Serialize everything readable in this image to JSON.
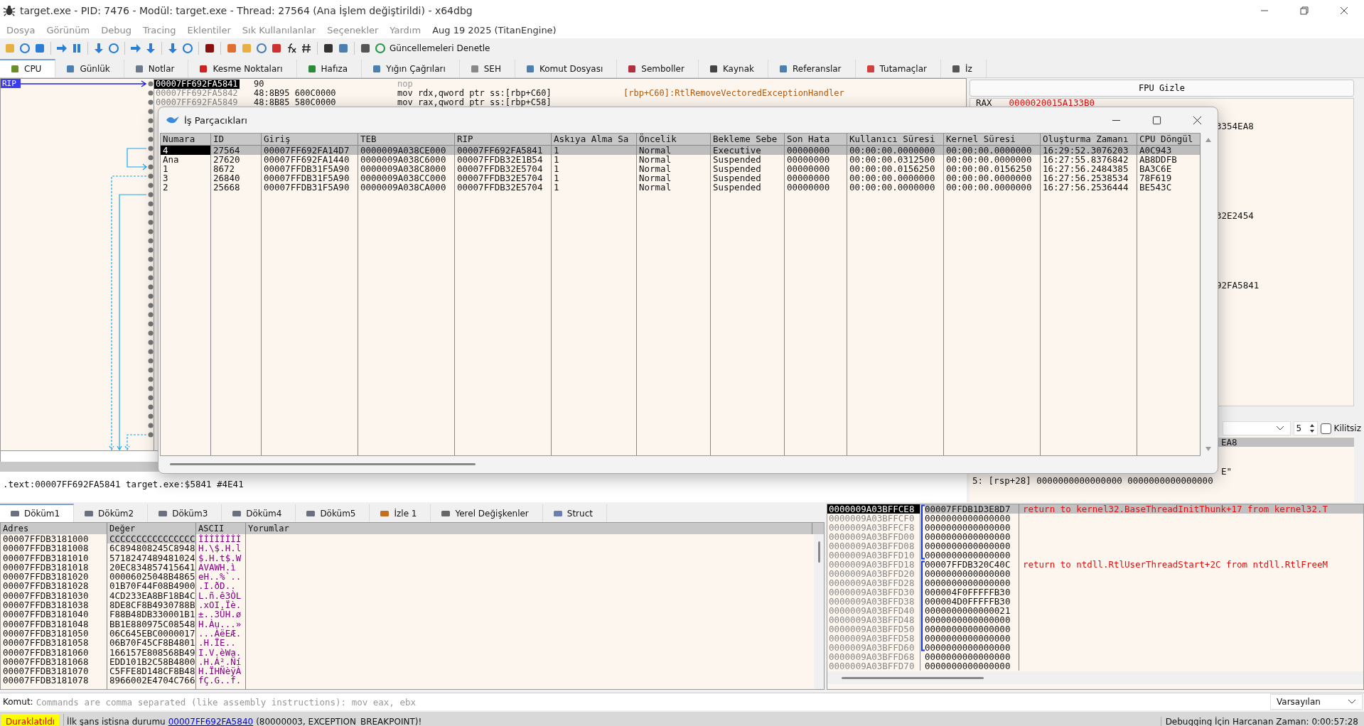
{
  "window": {
    "title": "target.exe - PID: 7476 - Modül: target.exe - Thread: 27564 (Ana İşlem değiştirildi) - x64dbg"
  },
  "menu": {
    "items": [
      "Dosya",
      "Görünüm",
      "Debug",
      "Tracing",
      "Eklentiler",
      "Sık Kullanılanlar",
      "Seçenekler",
      "Yardım"
    ],
    "build": "Aug 19 2025 (TitanEngine)"
  },
  "toolbar": {
    "update_label": "Güncellemeleri Denetle"
  },
  "tabs": [
    {
      "label": "CPU",
      "selected": true
    },
    {
      "label": "Günlük",
      "selected": false
    },
    {
      "label": "Notlar",
      "selected": false
    },
    {
      "label": "Kesme Noktaları",
      "selected": false
    },
    {
      "label": "Hafıza",
      "selected": false
    },
    {
      "label": "Yığın Çağrıları",
      "selected": false
    },
    {
      "label": "SEH",
      "selected": false
    },
    {
      "label": "Komut Dosyası",
      "selected": false
    },
    {
      "label": "Semboller",
      "selected": false
    },
    {
      "label": "Kaynak",
      "selected": false
    },
    {
      "label": "Referanslar",
      "selected": false
    },
    {
      "label": "Tutamaçlar",
      "selected": false
    },
    {
      "label": "İz",
      "selected": false
    }
  ],
  "disassembly": {
    "rip_label": "RIP",
    "rows": [
      {
        "address": "00007FF692FA5841",
        "bytes": "90",
        "instruction": "nop",
        "comment": null,
        "selected": true
      },
      {
        "address": "00007FF692FA5842",
        "bytes": "48:8B95 600C0000",
        "instruction": "mov rdx,qword ptr ss:[rbp+C60]",
        "comment": "[rbp+C60]:RtlRemoveVectoredExceptionHandler",
        "selected": false
      },
      {
        "address": "00007FF692FA5849",
        "bytes": "48:8B85 580C0000",
        "instruction": "mov rax,qword ptr ss:[rbp+C58]",
        "comment": null,
        "selected": false
      }
    ]
  },
  "info_line": ".text:00007FF692FA5841 target.exe:$5841 #4E41",
  "registers": {
    "toggle_label": "FPU Gizle",
    "rows": [
      {
        "name": "RAX",
        "value": "0000020015A133B0",
        "changed": true
      }
    ],
    "fragments": [
      "3354EA8",
      "32E2454",
      "92FA5841"
    ]
  },
  "arguments": {
    "count": "5",
    "lock_label": "Kilitsiz",
    "locked": false,
    "lines": [
      {
        "text": "EA8",
        "selected": true
      },
      {
        "text": "E\"",
        "selected": false
      },
      {
        "text": "5: [rsp+28] 0000000000000000 0000000000000000",
        "selected": false
      }
    ]
  },
  "threads_dialog": {
    "title": "İş Parçacıkları",
    "columns": [
      "Numara",
      "ID",
      "Giriş",
      "TEB",
      "RIP",
      "Askıya Alma Sa",
      "Öncelik",
      "Bekleme Sebe",
      "Son Hata",
      "Kullanıcı Süresi",
      "Kernel Süresi",
      "Oluşturma Zamanı",
      "CPU Döngül"
    ],
    "rows": [
      {
        "cells": [
          "4",
          "27564",
          "00007FF692FA14D7",
          "0000009A038CE000",
          "00007FF692FA5841",
          "1",
          "Normal",
          "Executive",
          "00000000",
          "00:00:00.0000000",
          "00:00:00.0000000",
          "16:29:52.3076203",
          "A0C943"
        ],
        "selected": true
      },
      {
        "cells": [
          "Ana",
          "27620",
          "00007FF692FA1440",
          "0000009A038C6000",
          "00007FFDB32E1B54",
          "1",
          "Normal",
          "Suspended",
          "00000000",
          "00:00:00.0312500",
          "00:00:00.0000000",
          "16:27:55.8376842",
          "AB8DDFB"
        ],
        "selected": false
      },
      {
        "cells": [
          "1",
          "8672",
          "00007FFDB31F5A90",
          "0000009A038C8000",
          "00007FFDB32E5704",
          "1",
          "Normal",
          "Suspended",
          "00000000",
          "00:00:00.0156250",
          "00:00:00.0156250",
          "16:27:56.2484385",
          "BA3C6E"
        ],
        "selected": false
      },
      {
        "cells": [
          "3",
          "26840",
          "00007FFDB31F5A90",
          "0000009A038CC000",
          "00007FFDB32E5704",
          "1",
          "Normal",
          "Suspended",
          "00000000",
          "00:00:00.0000000",
          "00:00:00.0000000",
          "16:27:56.2538534",
          "78F619"
        ],
        "selected": false
      },
      {
        "cells": [
          "2",
          "25668",
          "00007FFDB31F5A90",
          "0000009A038CA000",
          "00007FFDB32E5704",
          "1",
          "Normal",
          "Suspended",
          "00000000",
          "00:00:00.0000000",
          "00:00:00.0000000",
          "16:27:56.2536444",
          "BE543C"
        ],
        "selected": false
      }
    ]
  },
  "dump_tabs": [
    {
      "label": "Döküm1",
      "selected": true
    },
    {
      "label": "Döküm2",
      "selected": false
    },
    {
      "label": "Döküm3",
      "selected": false
    },
    {
      "label": "Döküm4",
      "selected": false
    },
    {
      "label": "Döküm5",
      "selected": false
    },
    {
      "label": "İzle 1",
      "selected": false
    },
    {
      "label": "Yerel Değişkenler",
      "selected": false
    },
    {
      "label": "Struct",
      "selected": false
    }
  ],
  "dump": {
    "columns": [
      "Adres",
      "Değer",
      "ASCII",
      "Yorumlar"
    ],
    "rows": [
      {
        "address": "00007FFDB3181000",
        "value": "CCCCCCCCCCCCCCCC",
        "ascii": "ÌÌÌÌÌÌÌÌ",
        "selected": true
      },
      {
        "address": "00007FFDB3181008",
        "value": "6C894808245C8948",
        "ascii": "H.\\$.H.l",
        "selected": false
      },
      {
        "address": "00007FFDB3181010",
        "value": "5718247489481024",
        "ascii": "$.H.t$.W",
        "selected": false
      },
      {
        "address": "00007FFDB3181018",
        "value": "20EC834857415641",
        "ascii": "AVAWH.ì",
        "selected": false
      },
      {
        "address": "00007FFDB3181020",
        "value": "00006025048B4865",
        "ascii": "eH..%`..",
        "selected": false
      },
      {
        "address": "00007FFDB3181028",
        "value": "01B70F44F08B4900",
        "ascii": ".I.ðD..",
        "selected": false
      },
      {
        "address": "00007FFDB3181030",
        "value": "4CD233EA8BF18B4C",
        "ascii": "L.ñ.ê3ÒL",
        "selected": false
      },
      {
        "address": "00007FFDB3181038",
        "value": "8DE8CF8B4930788B",
        "ascii": ".xOI.Ïè.",
        "selected": false
      },
      {
        "address": "00007FFDB3181040",
        "value": "F88B48DB330001B1",
        "ascii": "±..3ÛH.ø",
        "selected": false
      },
      {
        "address": "00007FFDB3181048",
        "value": "BB1E880975C08548",
        "ascii": "H.Àu...»",
        "selected": false
      },
      {
        "address": "00007FFDB3181050",
        "value": "06C645EBC0000017",
        "ascii": "...ÀëEÆ.",
        "selected": false
      },
      {
        "address": "00007FFDB3181058",
        "value": "06B70F45CF8B4801",
        "ascii": ".H.ÏE..",
        "selected": false
      },
      {
        "address": "00007FFDB3181060",
        "value": "166157E808568B49",
        "ascii": "I.V.èWa.",
        "selected": false
      },
      {
        "address": "00007FFDB3181068",
        "value": "EDD101B2C58B4800",
        "ascii": ".H.Á².Ñí",
        "selected": false
      },
      {
        "address": "00007FFDB3181070",
        "value": "C5FFE8D148CF8B48",
        "ascii": "H.ÏHÑèÿÀ",
        "selected": false
      },
      {
        "address": "00007FFDB3181078",
        "value": "8966002E4704C766",
        "ascii": "fÇ.G..f.",
        "selected": false
      }
    ]
  },
  "stack": {
    "frames": [
      {
        "rows": [
          {
            "address": "0000009A03BFFCE8",
            "value": "00007FFDB1D3E8D7",
            "comment": "return to kernel32.BaseThreadInitThunk+17 from kernel32.T",
            "selected": true
          },
          {
            "address": "0000009A03BFFCF0",
            "value": "0000000000000000",
            "selected": false
          },
          {
            "address": "0000009A03BFFCF8",
            "value": "0000000000000000",
            "selected": false
          },
          {
            "address": "0000009A03BFFD00",
            "value": "0000000000000000",
            "selected": false
          },
          {
            "address": "0000009A03BFFD08",
            "value": "0000000000000000",
            "selected": false
          },
          {
            "address": "0000009A03BFFD10",
            "value": "0000000000000000",
            "selected": false
          }
        ]
      },
      {
        "rows": [
          {
            "address": "0000009A03BFFD18",
            "value": "00007FFDB320C40C",
            "comment": "return to ntdll.RtlUserThreadStart+2C from ntdll.RtlFreeM",
            "selected": false
          },
          {
            "address": "0000009A03BFFD20",
            "value": "0000000000000000",
            "selected": false
          },
          {
            "address": "0000009A03BFFD28",
            "value": "0000000000000000",
            "selected": false
          },
          {
            "address": "0000009A03BFFD30",
            "value": "000004F0FFFFFB30",
            "selected": false
          },
          {
            "address": "0000009A03BFFD38",
            "value": "000004D0FFFFFB30",
            "selected": false
          },
          {
            "address": "0000009A03BFFD40",
            "value": "0000000000000021",
            "selected": false
          },
          {
            "address": "0000009A03BFFD48",
            "value": "0000000000000000",
            "selected": false
          },
          {
            "address": "0000009A03BFFD50",
            "value": "0000000000000000",
            "selected": false
          },
          {
            "address": "0000009A03BFFD58",
            "value": "0000000000000000",
            "selected": false
          },
          {
            "address": "0000009A03BFFD60",
            "value": "0000000000000000",
            "selected": false
          }
        ]
      }
    ],
    "rows": [
      {
        "address": "0000009A03BFFD68",
        "value": "0000000000000000",
        "selected": false
      },
      {
        "address": "0000009A03BFFD70",
        "value": "0000000000000000",
        "selected": false
      }
    ]
  },
  "command": {
    "label": "Komut:",
    "placeholder": "Commands are comma separated (like assembly instructions): mov eax, ebx",
    "mode": "Varsayılan"
  },
  "status_bar": {
    "state": "Duraklatıldı",
    "message_prefix": "İlk şans istisna durumu",
    "link": "00007FF692FA5840",
    "message_suffix": "(80000003, EXCEPTION_BREAKPOINT)!",
    "elapsed": "Debugging İçin Harcanan Zaman: 0:00:57:28"
  }
}
